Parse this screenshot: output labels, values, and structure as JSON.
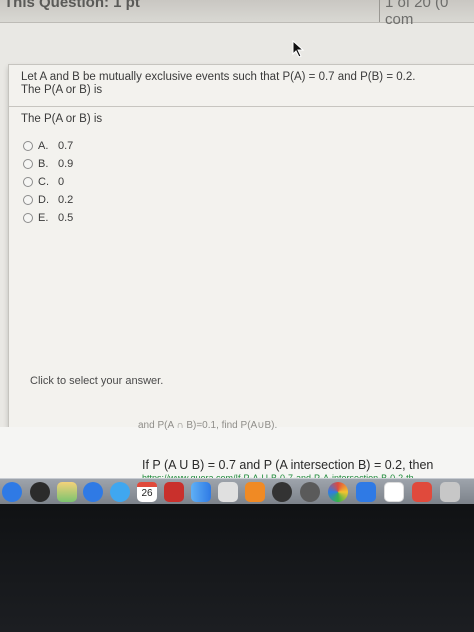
{
  "header": {
    "title": "This Question: 1 pt",
    "counter": "1 of 20 (0 com"
  },
  "question": {
    "text_line1": "Let A and B be mutually exclusive events such that P(A) = 0.7 and P(B) = 0.2.",
    "text_line2": "The P(A or B) is",
    "prompt": "The P(A or B) is",
    "options": [
      {
        "letter": "A.",
        "value": "0.7"
      },
      {
        "letter": "B.",
        "value": "0.9"
      },
      {
        "letter": "C.",
        "value": "0"
      },
      {
        "letter": "D.",
        "value": "0.2"
      },
      {
        "letter": "E.",
        "value": "0.5"
      }
    ],
    "hint": "Click to select your answer."
  },
  "background": {
    "ghost_text": "and P(A ∩ B)=0.1, find P(A∪B).",
    "search_text": "If P (A U B) = 0.7 and P (A intersection B) = 0.2, then",
    "url_text": "https://www.quora.com/If-P-A-U-B-0-7-and-P-A-intersection-B-0-2-th"
  },
  "dock": {
    "calendar_day": "26",
    "icons": [
      "app-store-icon",
      "system-icon",
      "maps-icon",
      "safari-icon",
      "messages-icon",
      "calendar-icon",
      "photos-booth-icon",
      "finder-icon",
      "launchpad-icon",
      "settings-icon",
      "itunes-icon",
      "chrome-icon",
      "photos-icon",
      "powerpoint-icon",
      "notes-icon",
      "music-icon"
    ],
    "colors": {
      "blue": "#2f7ae5",
      "red": "#e04a3c",
      "green": "#37b34a",
      "orange": "#f08a24"
    }
  }
}
